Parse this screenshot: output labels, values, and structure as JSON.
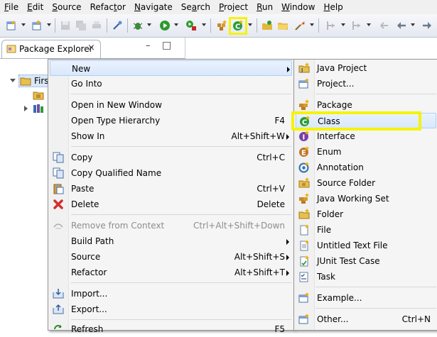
{
  "menubar": [
    {
      "pre": "",
      "key": "F",
      "post": "ile"
    },
    {
      "pre": "",
      "key": "E",
      "post": "dit"
    },
    {
      "pre": "",
      "key": "S",
      "post": "ource"
    },
    {
      "pre": "Refac",
      "key": "t",
      "post": "or"
    },
    {
      "pre": "",
      "key": "N",
      "post": "avigate"
    },
    {
      "pre": "Se",
      "key": "a",
      "post": "rch"
    },
    {
      "pre": "",
      "key": "P",
      "post": "roject"
    },
    {
      "pre": "",
      "key": "R",
      "post": "un"
    },
    {
      "pre": "",
      "key": "W",
      "post": "indow"
    },
    {
      "pre": "",
      "key": "H",
      "post": "elp"
    }
  ],
  "toolbar": {
    "icons": [
      "new-icon",
      "new-dropdown-icon",
      "save-icon",
      "save-all-icon",
      "print-icon",
      "pin-icon",
      "debug-icon",
      "run-icon",
      "run-external-icon",
      "new-java-package-icon",
      "new-java-class-icon",
      "open-type-icon",
      "open-folder-icon",
      "search-icon",
      "annotation-nav-icon",
      "next-icon",
      "back-icon",
      "forward-icon"
    ],
    "highlight_color": "#f5f30a"
  },
  "view": {
    "title": "Package Explorer",
    "close_glyph": "×",
    "minimize_glyph": "–",
    "maximize_glyph": "□",
    "tree": [
      {
        "label": "First",
        "expanded": true
      },
      {
        "label": "",
        "icon": "src-folder-icon"
      },
      {
        "label": "",
        "icon": "library-icon"
      }
    ]
  },
  "context_menu": {
    "items": [
      {
        "label": "New",
        "shortcut": "",
        "submenu": true,
        "hover": true
      },
      {
        "label": "Go Into",
        "shortcut": ""
      },
      {
        "label": "Open in New Window",
        "shortcut": ""
      },
      {
        "label": "Open Type Hierarchy",
        "shortcut": "F4"
      },
      {
        "label": "Show In",
        "shortcut": "Alt+Shift+W",
        "submenu": true
      },
      {
        "label": "Copy",
        "shortcut": "Ctrl+C",
        "icon": "copy-icon"
      },
      {
        "label": "Copy Qualified Name",
        "shortcut": "",
        "icon": "copy-qualified-icon"
      },
      {
        "label": "Paste",
        "shortcut": "Ctrl+V",
        "icon": "paste-icon"
      },
      {
        "label": "Delete",
        "shortcut": "Delete",
        "icon": "delete-icon"
      },
      {
        "label": "Remove from Context",
        "shortcut": "Ctrl+Alt+Shift+Down",
        "icon": "remove-context-icon",
        "disabled": true
      },
      {
        "label": "Build Path",
        "shortcut": "",
        "submenu": true
      },
      {
        "label": "Source",
        "shortcut": "Alt+Shift+S",
        "submenu": true
      },
      {
        "label": "Refactor",
        "shortcut": "Alt+Shift+T",
        "submenu": true
      },
      {
        "label": "Import...",
        "shortcut": "",
        "icon": "import-icon"
      },
      {
        "label": "Export...",
        "shortcut": "",
        "icon": "export-icon"
      },
      {
        "label": "Refresh",
        "shortcut": "F5",
        "icon": "refresh-icon"
      }
    ]
  },
  "new_submenu": {
    "items": [
      {
        "label": "Java Project",
        "icon": "java-project-icon"
      },
      {
        "label": "Project...",
        "icon": "project-icon"
      },
      {
        "label": "Package",
        "icon": "package-icon"
      },
      {
        "label": "Class",
        "icon": "class-icon",
        "hover": true
      },
      {
        "label": "Interface",
        "icon": "interface-icon"
      },
      {
        "label": "Enum",
        "icon": "enum-icon"
      },
      {
        "label": "Annotation",
        "icon": "annotation-icon"
      },
      {
        "label": "Source Folder",
        "icon": "source-folder-icon"
      },
      {
        "label": "Java Working Set",
        "icon": "working-set-icon"
      },
      {
        "label": "Folder",
        "icon": "folder-icon"
      },
      {
        "label": "File",
        "icon": "file-icon"
      },
      {
        "label": "Untitled Text File",
        "icon": "text-file-icon"
      },
      {
        "label": "JUnit Test Case",
        "icon": "junit-icon"
      },
      {
        "label": "Task",
        "icon": "task-icon"
      },
      {
        "label": "Example...",
        "icon": "example-icon"
      },
      {
        "label": "Other...",
        "shortcut": "Ctrl+N",
        "icon": "other-wizard-icon"
      }
    ],
    "highlight_color": "#f5f30a"
  }
}
